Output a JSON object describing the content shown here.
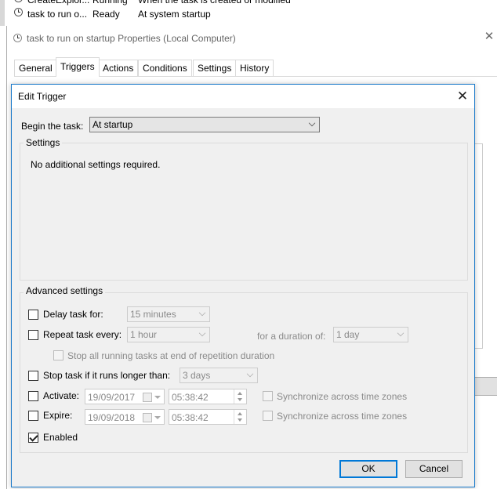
{
  "task_list": {
    "rows": [
      {
        "name": "CreateExplor...",
        "status": "Running",
        "trigger": "When the task is created or modified"
      },
      {
        "name": "task to run o...",
        "status": "Ready",
        "trigger": "At system startup"
      }
    ]
  },
  "properties_window": {
    "title": "task to run on startup Properties (Local Computer)",
    "close_glyph": "✕",
    "tabs": [
      {
        "label": "General",
        "active": false
      },
      {
        "label": "Triggers",
        "active": true
      },
      {
        "label": "Actions",
        "active": false
      },
      {
        "label": "Conditions",
        "active": false
      },
      {
        "label": "Settings",
        "active": false
      },
      {
        "label": "History",
        "active": false
      }
    ]
  },
  "edit_trigger": {
    "title": "Edit Trigger",
    "close_glyph": "✕",
    "begin_label": "Begin the task:",
    "begin_value": "At startup",
    "settings_legend": "Settings",
    "settings_text": "No additional settings required.",
    "advanced_legend": "Advanced settings",
    "delay": {
      "label": "Delay task for:",
      "value": "15 minutes",
      "checked": false
    },
    "repeat": {
      "label": "Repeat task every:",
      "value": "1 hour",
      "checked": false,
      "duration_label": "for a duration of:",
      "duration_value": "1 day"
    },
    "stop_all": {
      "label": "Stop all running tasks at end of repetition duration",
      "checked": false
    },
    "stop_longer": {
      "label": "Stop task if it runs longer than:",
      "value": "3 days",
      "checked": false
    },
    "activate": {
      "label": "Activate:",
      "date": "19/09/2017",
      "time": "05:38:42",
      "checked": false,
      "sync_label": "Synchronize across time zones"
    },
    "expire": {
      "label": "Expire:",
      "date": "19/09/2018",
      "time": "05:38:42",
      "checked": false,
      "sync_label": "Synchronize across time zones"
    },
    "enabled": {
      "label": "Enabled",
      "checked": true
    },
    "ok_label": "OK",
    "cancel_label": "Cancel"
  },
  "colors": {
    "accent": "#0078d7",
    "dialog_border": "#1979ca",
    "dialog_bg": "#f0f0f0",
    "disabled_text": "#8a8a8a"
  }
}
